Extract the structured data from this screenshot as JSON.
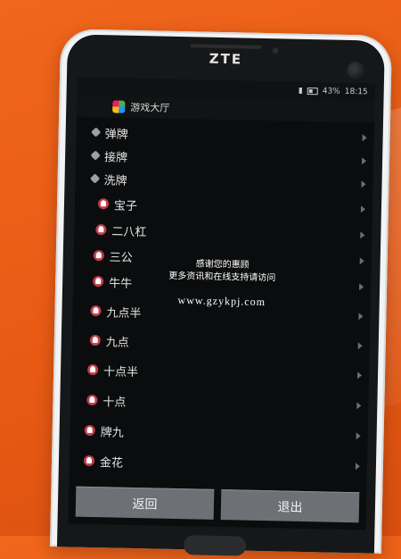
{
  "device": {
    "brand": "ZTE"
  },
  "statusbar": {
    "battery": "43%",
    "time": "18:15"
  },
  "appbar": {
    "title": "游戏大厅"
  },
  "categories": [
    {
      "label": "弹牌"
    },
    {
      "label": "接牌"
    },
    {
      "label": "洗牌"
    }
  ],
  "games": [
    {
      "label": "宝子"
    },
    {
      "label": "二八杠"
    },
    {
      "label": "三公"
    },
    {
      "label": "牛牛"
    },
    {
      "label": "九点半"
    },
    {
      "label": "九点"
    },
    {
      "label": "十点半"
    },
    {
      "label": "十点"
    },
    {
      "label": "牌九"
    },
    {
      "label": "金花"
    }
  ],
  "overlay": {
    "line1": "感谢您的惠顾",
    "line2": "更多资讯和在线支持请访问",
    "url": "www.gzykpj.com"
  },
  "buttons": {
    "back": "返回",
    "exit": "退出"
  },
  "colors": {
    "background": "#e85a14",
    "button": "#6d7176",
    "game_icon": "#c23d4b"
  }
}
